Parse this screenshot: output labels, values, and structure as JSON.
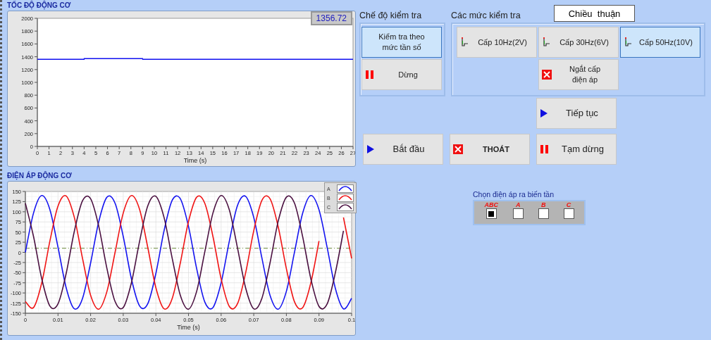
{
  "speed_panel": {
    "title": "TỐC ĐỘ ĐỘNG CƠ",
    "readout": "1356.72",
    "chart_data": {
      "type": "line",
      "xlabel": "Time (s)",
      "xlim": [
        0,
        27
      ],
      "ylim": [
        0,
        2000
      ],
      "xticks": [
        0,
        1,
        2,
        3,
        4,
        5,
        6,
        7,
        8,
        9,
        10,
        11,
        12,
        13,
        14,
        15,
        16,
        17,
        18,
        19,
        20,
        21,
        22,
        23,
        24,
        25,
        26,
        27
      ],
      "yticks": [
        0,
        200,
        400,
        600,
        800,
        1000,
        1200,
        1400,
        1600,
        1800,
        2000
      ],
      "x": [
        0,
        1,
        2,
        3,
        4,
        4.01,
        5,
        6,
        7,
        8,
        9,
        9.01,
        10,
        11,
        12,
        13,
        14,
        15,
        16,
        17,
        18,
        19,
        20,
        21,
        22,
        23,
        24,
        25,
        26,
        27
      ],
      "series": [
        {
          "color": "#1010f0",
          "values": [
            1360,
            1360,
            1360,
            1360,
            1360,
            1370,
            1370,
            1370,
            1370,
            1370,
            1370,
            1360,
            1360,
            1360,
            1360,
            1360,
            1360,
            1360,
            1360,
            1360,
            1360,
            1360,
            1360,
            1360,
            1360,
            1360,
            1360,
            1360,
            1360,
            1360
          ]
        }
      ]
    }
  },
  "voltage_panel": {
    "title": "ĐIỆN ÁP ĐỘNG CƠ",
    "chart_data": {
      "type": "line",
      "xlabel": "Time (s)",
      "xlim": [
        0,
        0.1
      ],
      "ylim": [
        -150,
        150
      ],
      "xticks": [
        0,
        0.01,
        0.02,
        0.03,
        0.04,
        0.05,
        0.06,
        0.07,
        0.08,
        0.09,
        0.1
      ],
      "yticks": [
        -150,
        -125,
        -100,
        -75,
        -50,
        -25,
        0,
        25,
        50,
        75,
        100,
        125,
        150
      ],
      "x": [
        0,
        0.0025,
        0.005,
        0.0075,
        0.01,
        0.0125,
        0.015,
        0.0175,
        0.02,
        0.0225,
        0.025,
        0.0275,
        0.03,
        0.0325,
        0.035,
        0.0375,
        0.04,
        0.0425,
        0.045,
        0.0475,
        0.05,
        0.0525,
        0.055,
        0.0575,
        0.06,
        0.0625,
        0.065,
        0.0675,
        0.07,
        0.0725,
        0.075,
        0.0775,
        0.08,
        0.0825,
        0.085,
        0.0875,
        0.09,
        0.0925,
        0.095,
        0.0975,
        0.1
      ],
      "series": [
        {
          "name": "A",
          "color": "#1414f0",
          "values": [
            0,
            97,
            140,
            106,
            13,
            -87,
            -139,
            -114,
            -26,
            76,
            136,
            121,
            39,
            -65,
            -132,
            -127,
            -52,
            53,
            128,
            132,
            64,
            -40,
            -122,
            -136,
            -75,
            27,
            115,
            138,
            86,
            -14,
            -106,
            -140,
            -96,
            1,
            97,
            140,
            105,
            12,
            -88,
            -139,
            -113
          ]
        },
        {
          "name": "B",
          "color": "#f01414",
          "values": [
            -121,
            -136,
            -76,
            27,
            114,
            139,
            86,
            -14,
            -106,
            -140,
            -96,
            0,
            97,
            140,
            106,
            13,
            -87,
            -139,
            -114,
            -26,
            76,
            136,
            121,
            39,
            -65,
            -133,
            -127,
            -51,
            53,
            128,
            132,
            63,
            -40,
            -122,
            -136,
            -75,
            28,
            null,
            null,
            86,
            -15
          ]
        },
        {
          "name": "C",
          "color": "#4a1040",
          "values": [
            121,
            39,
            -64,
            -132,
            -127,
            -52,
            52,
            127,
            132,
            64,
            -40,
            -121,
            -136,
            -75,
            27,
            114,
            138,
            86,
            -14,
            -106,
            -140,
            -96,
            1,
            97,
            140,
            105,
            12,
            -87,
            -139,
            -113,
            -26,
            77,
            136,
            121,
            38,
            -65,
            -133,
            -127,
            -51,
            53,
            null
          ]
        },
        {
          "color": "#6a8a3a",
          "line_style": "dashdot",
          "values": [
            10,
            10,
            10,
            10,
            10,
            10,
            10,
            10,
            10,
            10,
            10,
            10,
            10,
            10,
            10,
            10,
            10,
            10,
            10,
            10,
            10,
            10,
            10,
            10,
            10,
            10,
            10,
            10,
            10,
            10,
            10,
            10,
            10,
            10,
            10,
            10,
            10,
            10,
            10,
            10,
            10
          ]
        }
      ],
      "grid": true
    }
  },
  "mode_group": {
    "label": "Chế độ kiểm tra",
    "buttons": [
      {
        "label": "Kiểm tra theo\nmức tần số",
        "kind": "plain",
        "selected": true
      },
      {
        "label": "Dừng",
        "kind": "pause",
        "selected": false
      }
    ]
  },
  "level_group": {
    "label": "Các mức kiểm tra",
    "direction": "Chiều  thuận",
    "buttons": [
      {
        "label": "Cấp 10Hz(2V)",
        "kind": "step",
        "selected": false
      },
      {
        "label": "Cấp 30Hz(6V)",
        "kind": "step",
        "selected": false
      },
      {
        "label": "Cấp 50Hz(10V)",
        "kind": "step",
        "selected": true
      },
      {
        "label": "Ngắt cấp\nđiện áp",
        "kind": "stop",
        "selected": false
      }
    ]
  },
  "resume_button": {
    "label": "Tiếp tục",
    "kind": "play"
  },
  "action_buttons": [
    {
      "label": "Bắt đầu",
      "kind": "play",
      "bold": false
    },
    {
      "label": "THOÁT",
      "kind": "stop",
      "bold": true
    },
    {
      "label": "Tạm dừng",
      "kind": "pause",
      "bold": false
    }
  ],
  "output_select": {
    "label": "Chọn điện áp ra biến tần",
    "options": [
      {
        "label": "ABC",
        "checked": true
      },
      {
        "label": "A",
        "checked": false
      },
      {
        "label": "B",
        "checked": false
      },
      {
        "label": "C",
        "checked": false
      }
    ]
  }
}
